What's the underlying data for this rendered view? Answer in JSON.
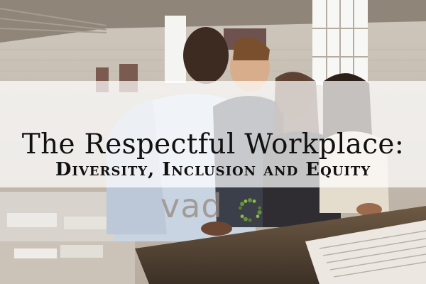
{
  "heading": {
    "title": "The Respectful Workplace:",
    "subtitle": "Diversity, Inclusion and Equity"
  },
  "logo": {
    "text": "vad",
    "ring_colors": [
      "#6a8f3c",
      "#8cbf3f",
      "#3f3f3f",
      "#5a7d2e"
    ]
  },
  "photo": {
    "description_icon": "office-team-photo"
  }
}
